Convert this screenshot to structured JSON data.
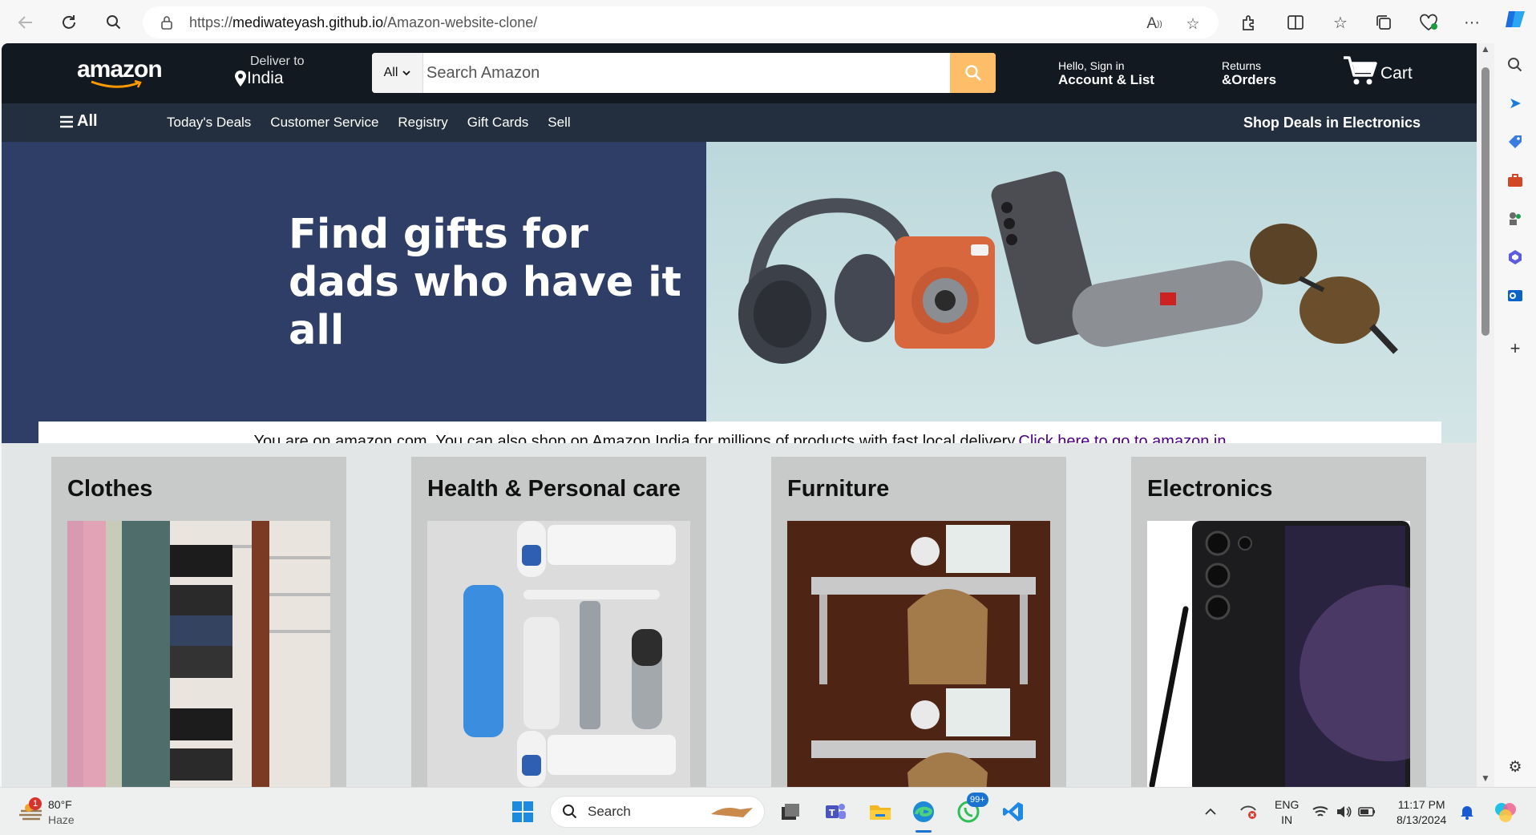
{
  "browser": {
    "url_prefix": "https://",
    "url_host": "mediwateyash.github.io",
    "url_path": "/Amazon-website-clone/"
  },
  "header": {
    "logo": "amazon",
    "deliver_small": "Deliver to",
    "deliver_location": "India",
    "search_category": "All",
    "search_placeholder": "Search Amazon",
    "account_small": "Hello, Sign in",
    "account_big": "Account & List",
    "orders_small": "Returns",
    "orders_big": "&Orders",
    "cart_label": "Cart"
  },
  "subnav": {
    "all_label": "All",
    "links": [
      "Today's Deals",
      "Customer Service",
      "Registry",
      "Gift Cards",
      "Sell"
    ],
    "deals_label": "Shop Deals in Electronics"
  },
  "hero": {
    "line1": "Find gifts for",
    "line2": "dads who have it all"
  },
  "notice": {
    "text": "You are on amazon.com. You can also shop on Amazon India for millions of products with fast local delivery.",
    "link": "Click here to go to amazon.in"
  },
  "cards": [
    {
      "title": "Clothes"
    },
    {
      "title": "Health & Personal care"
    },
    {
      "title": "Furniture"
    },
    {
      "title": "Electronics"
    }
  ],
  "taskbar": {
    "weather_temp": "80°F",
    "weather_desc": "Haze",
    "weather_badge": "1",
    "search_label": "Search",
    "whatsapp_badge": "99+",
    "lang_top": "ENG",
    "lang_bottom": "IN",
    "time": "11:17 PM",
    "date": "8/13/2024"
  },
  "colors": {
    "header_bg": "#131921",
    "subnav_bg": "#232f3e",
    "search_button": "#febd69",
    "hero_left": "#2f3e66",
    "link": "#4b0082"
  }
}
